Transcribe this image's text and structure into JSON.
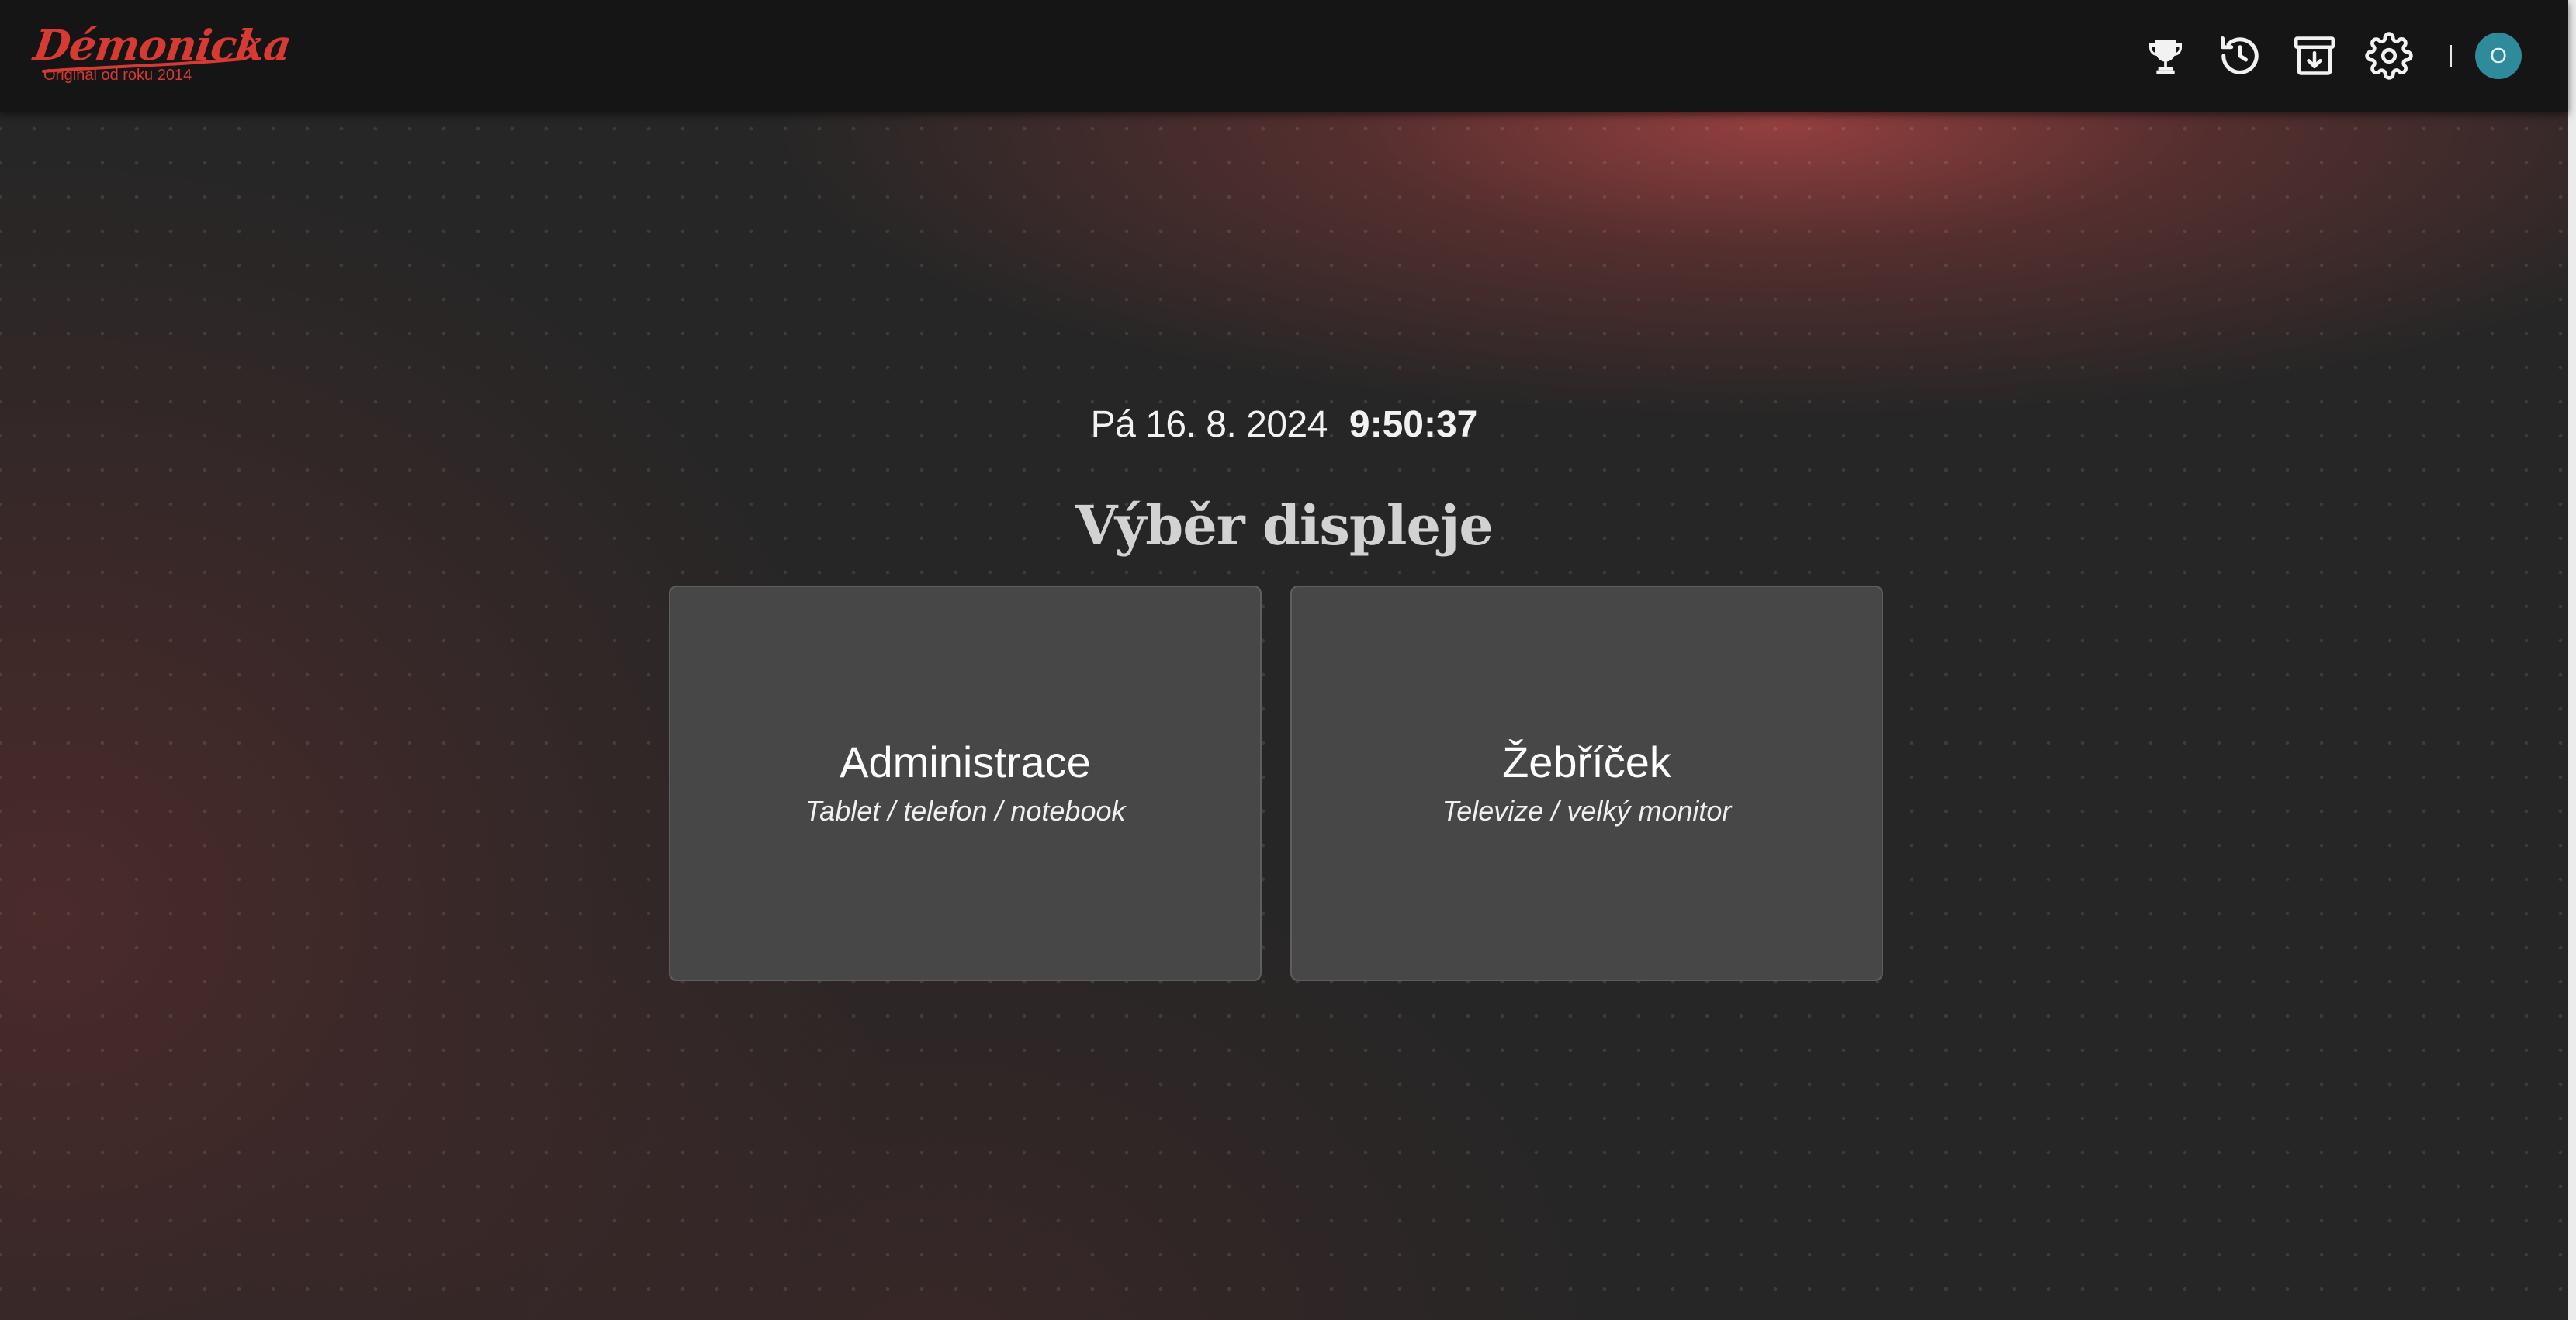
{
  "brand": {
    "name": "Démonicka",
    "tagline": "Originál od roku 2014",
    "color": "#d63a33"
  },
  "nav": {
    "icons": [
      {
        "name": "trophy-icon"
      },
      {
        "name": "history-icon"
      },
      {
        "name": "archive-download-icon"
      },
      {
        "name": "gear-icon"
      }
    ],
    "avatar_initial": "O",
    "avatar_color": "#2f8a9c"
  },
  "clock": {
    "date": "Pá 16. 8. 2024",
    "time": "9:50:37"
  },
  "main": {
    "title": "Výběr displeje",
    "cards": [
      {
        "title": "Administrace",
        "subtitle": "Tablet / telefon / notebook"
      },
      {
        "title": "Žebříček",
        "subtitle": "Televize / velký monitor"
      }
    ]
  },
  "colors": {
    "navbar": "#151515",
    "background": "#262626",
    "card": "#474747",
    "accent_glow": "#b24646"
  }
}
